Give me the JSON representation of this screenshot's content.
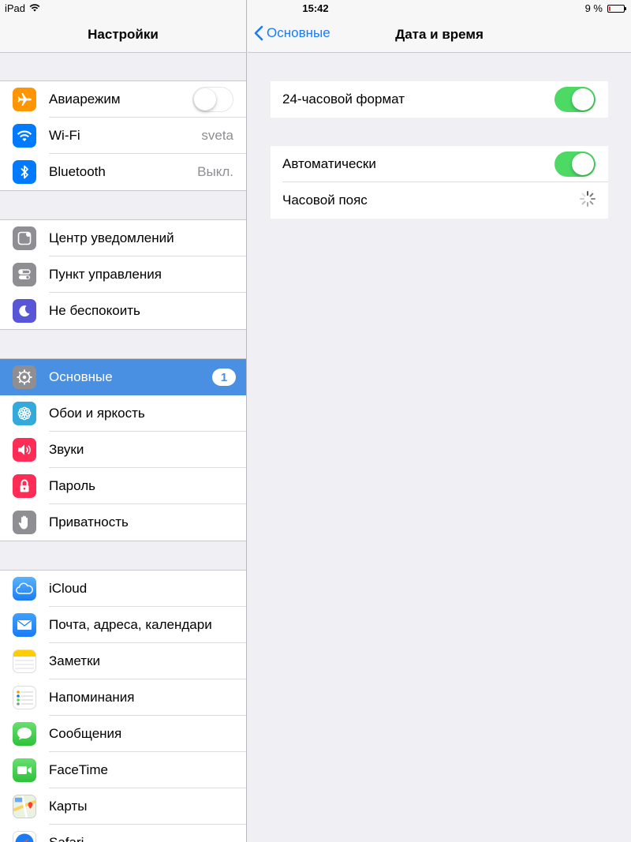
{
  "statusbar": {
    "device": "iPad",
    "time": "15:42",
    "battery": "9 %",
    "battery_level": 0.09
  },
  "left": {
    "title": "Настройки",
    "groups": [
      [
        {
          "label": "Авиарежим",
          "icon": "airplane-icon",
          "color": "#ff9500",
          "toggle": "off"
        },
        {
          "label": "Wi-Fi",
          "icon": "wifi-icon",
          "color": "#007aff",
          "value": "sveta"
        },
        {
          "label": "Bluetooth",
          "icon": "bluetooth-icon",
          "color": "#007aff",
          "value": "Выкл."
        }
      ],
      [
        {
          "label": "Центр уведомлений",
          "icon": "notification-center-icon",
          "color": "#8e8e93"
        },
        {
          "label": "Пункт управления",
          "icon": "control-center-icon",
          "color": "#8e8e93"
        },
        {
          "label": "Не беспокоить",
          "icon": "moon-icon",
          "color": "#5856d6"
        }
      ],
      [
        {
          "label": "Основные",
          "icon": "gear-icon",
          "color": "#8e8e93",
          "badge": "1",
          "selected": true
        },
        {
          "label": "Обои и яркость",
          "icon": "wallpaper-icon",
          "color": "#34aadc"
        },
        {
          "label": "Звуки",
          "icon": "speaker-icon",
          "color": "#ff2d55"
        },
        {
          "label": "Пароль",
          "icon": "lock-icon",
          "color": "#ff2d55"
        },
        {
          "label": "Приватность",
          "icon": "hand-icon",
          "color": "#8e8e93"
        }
      ],
      [
        {
          "label": "iCloud",
          "icon": "cloud-icon",
          "color": "#1a7cf5"
        },
        {
          "label": "Почта, адреса, календари",
          "icon": "mail-icon",
          "color": "#1a7cf5"
        },
        {
          "label": "Заметки",
          "icon": "notes-icon",
          "color": "#ffcc00"
        },
        {
          "label": "Напоминания",
          "icon": "reminders-icon",
          "color": "#ffffff"
        },
        {
          "label": "Сообщения",
          "icon": "messages-icon",
          "color": "#4cd964"
        },
        {
          "label": "FaceTime",
          "icon": "facetime-icon",
          "color": "#4cd964"
        },
        {
          "label": "Карты",
          "icon": "maps-icon",
          "color": "#d9ecd0"
        },
        {
          "label": "Safari",
          "icon": "safari-icon",
          "color": "#1a7cf5"
        }
      ]
    ]
  },
  "right": {
    "back_label": "Основные",
    "title": "Дата и время",
    "format_24h": {
      "label": "24-часовой формат",
      "state": "on"
    },
    "automatic": {
      "label": "Автоматически",
      "state": "on"
    },
    "timezone": {
      "label": "Часовой пояс"
    }
  },
  "colors": {
    "accent": "#1a7cf5",
    "selected_row": "#4a90e2",
    "toggle_on": "#4cd964"
  }
}
